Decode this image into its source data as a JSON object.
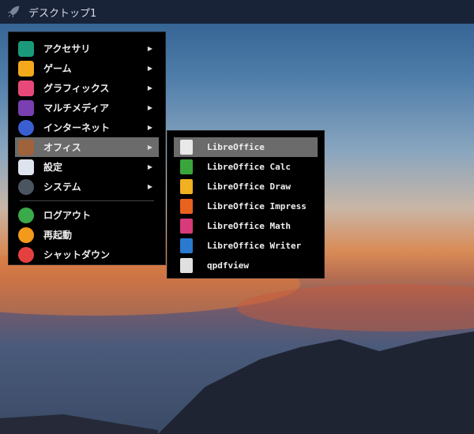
{
  "taskbar": {
    "title": "デスクトップ1",
    "icon": "rocket-icon"
  },
  "main_menu": {
    "items": [
      {
        "label": "アクセサリ",
        "icon": "accessories-icon",
        "submenu": true,
        "color": "#1a9a7a"
      },
      {
        "label": "ゲーム",
        "icon": "gamepad-icon",
        "submenu": true,
        "color": "#f4a81c"
      },
      {
        "label": "グラフィックス",
        "icon": "graphics-icon",
        "submenu": true,
        "color": "#e8487a"
      },
      {
        "label": "マルチメディア",
        "icon": "multimedia-icon",
        "submenu": true,
        "color": "#7a3fb0"
      },
      {
        "label": "インターネット",
        "icon": "internet-icon",
        "submenu": true,
        "color": "#3a5fd0"
      },
      {
        "label": "オフィス",
        "icon": "briefcase-icon",
        "submenu": true,
        "color": "#a0623a"
      },
      {
        "label": "設定",
        "icon": "settings-icon",
        "submenu": true,
        "color": "#dde4ee"
      },
      {
        "label": "システム",
        "icon": "gear-icon",
        "submenu": true,
        "color": "#4a5560"
      }
    ],
    "session_items": [
      {
        "label": "ログアウト",
        "icon": "logout-icon",
        "color": "#3aaa4a"
      },
      {
        "label": "再起動",
        "icon": "restart-icon",
        "color": "#f39a1a"
      },
      {
        "label": "シャットダウン",
        "icon": "power-icon",
        "color": "#e54040"
      }
    ],
    "arrow": "▶"
  },
  "office_menu": {
    "items": [
      {
        "label": "LibreOffice",
        "icon": "libreoffice-icon",
        "color": "#e8e8e8"
      },
      {
        "label": "LibreOffice Calc",
        "icon": "calc-icon",
        "color": "#3aa53a"
      },
      {
        "label": "LibreOffice Draw",
        "icon": "draw-icon",
        "color": "#f0b020"
      },
      {
        "label": "LibreOffice Impress",
        "icon": "impress-icon",
        "color": "#e8621e"
      },
      {
        "label": "LibreOffice Math",
        "icon": "math-icon",
        "color": "#d83a7a"
      },
      {
        "label": "LibreOffice Writer",
        "icon": "writer-icon",
        "color": "#2a7ad0"
      },
      {
        "label": "qpdfview",
        "icon": "qpdfview-icon",
        "color": "#e0e0e0"
      }
    ]
  }
}
